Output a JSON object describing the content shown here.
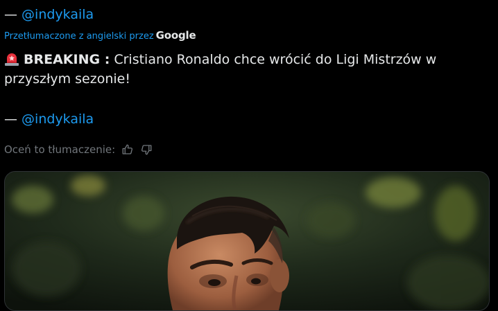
{
  "tweet": {
    "top_prefix": "— ",
    "top_mention": "@indykaila",
    "translated_by": "Przetłumaczone z angielski przez",
    "translator": "Google",
    "siren_icon": "police-light-emoji",
    "breaking_label": "BREAKING :",
    "text": " Cristiano Ronaldo chce wrócić do Ligi Mistrzów w przyszłym sezonie!",
    "signature_prefix": "— ",
    "signature_mention": "@indykaila",
    "rate_label": "Oceń to tłumaczenie:",
    "rate_up_icon": "thumbs-up-icon",
    "rate_down_icon": "thumbs-down-icon"
  },
  "colors": {
    "background": "#000000",
    "text": "#e7e9ea",
    "link": "#1d9bf0",
    "muted": "#71767b"
  },
  "media": {
    "type": "photo",
    "subject": "football-player-photo"
  }
}
